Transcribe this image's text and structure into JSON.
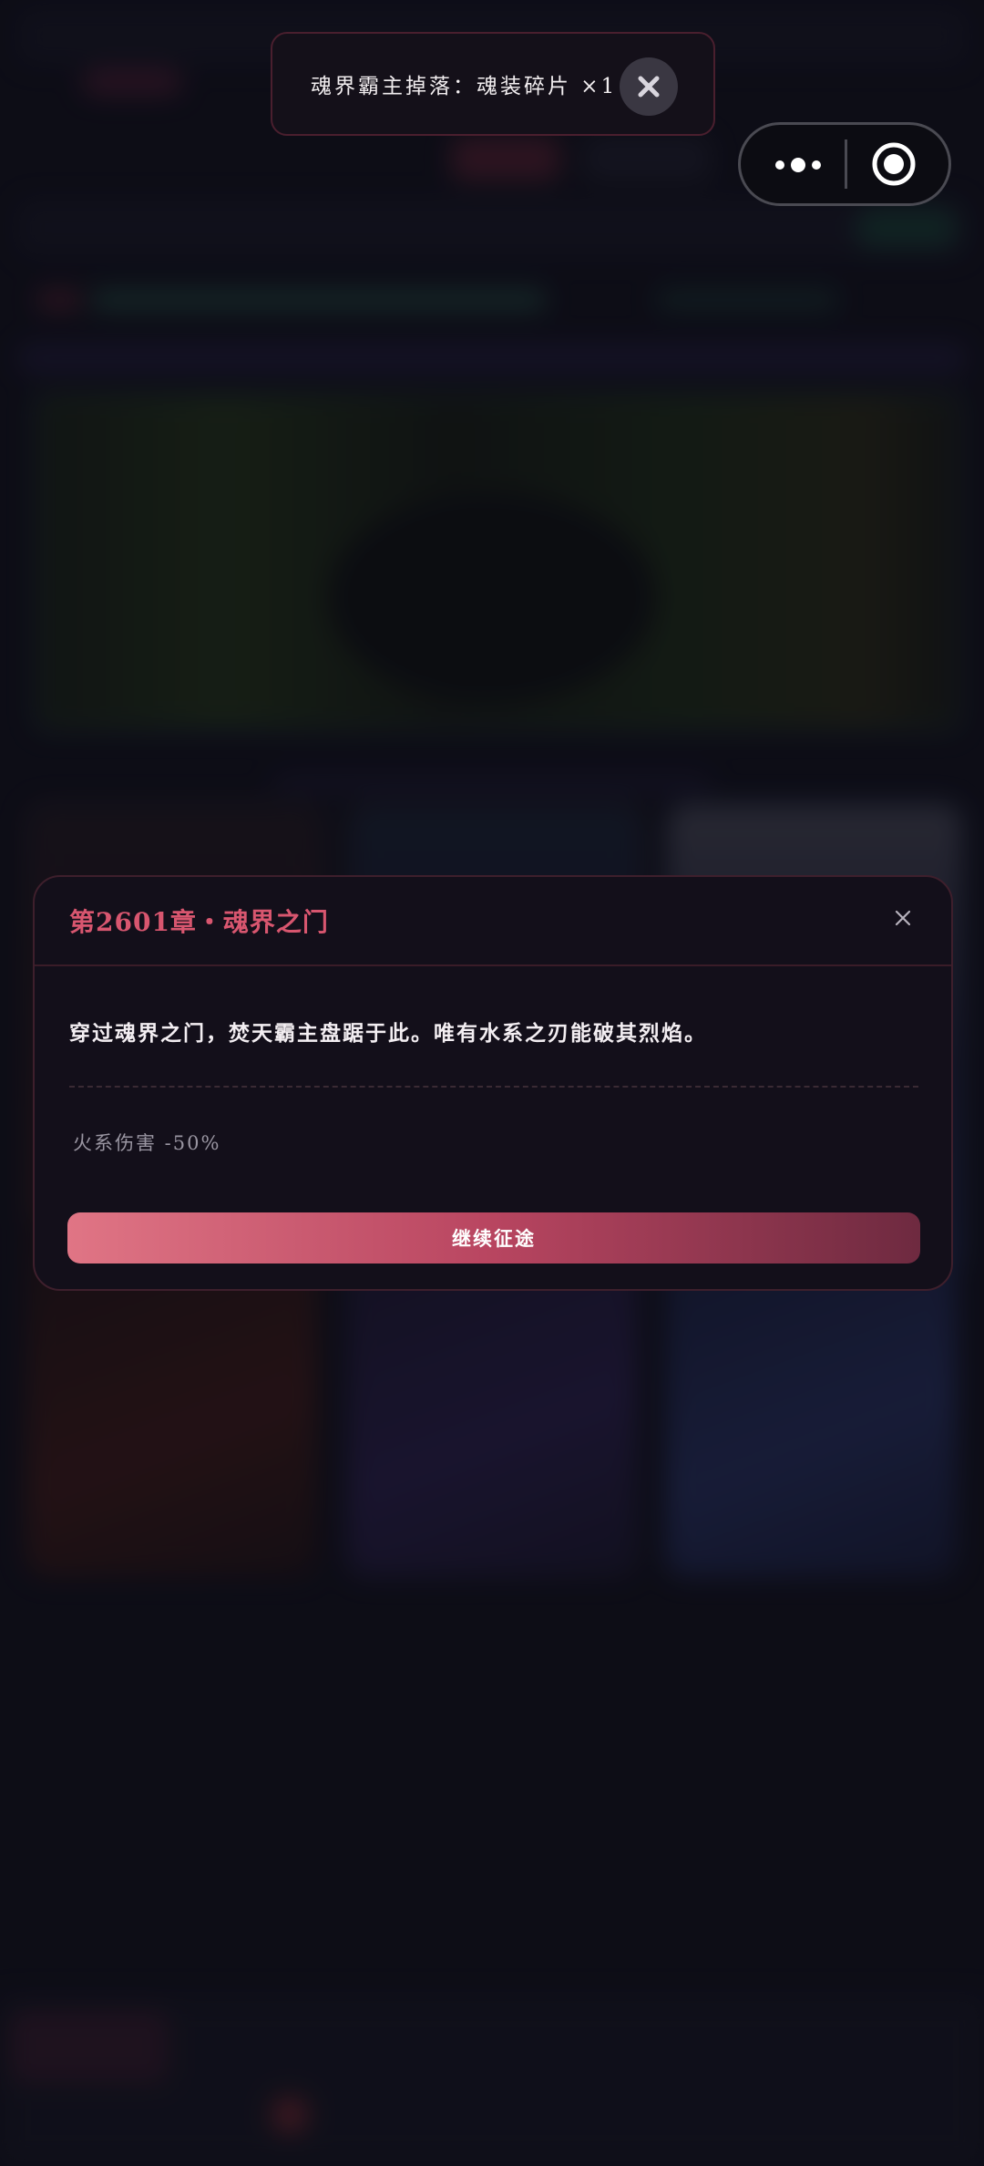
{
  "toast": {
    "message": "魂界霸主掉落：魂装碎片 ×1",
    "close_icon": "close-icon"
  },
  "capsule": {
    "more_icon": "more-dots-icon",
    "close_icon": "target-circle-icon"
  },
  "modal": {
    "title": "第2601章・魂界之门",
    "close_icon": "close-icon",
    "description": "穿过魂界之门，焚天霸主盘踞于此。唯有水系之刃能破其烈焰。",
    "effect": "火系伤害 -50%",
    "button_label": "继续征途"
  },
  "colors": {
    "accent_title": "#d8566f",
    "button_gradient_start": "#e07585",
    "button_gradient_end": "#6e2a40",
    "modal_bg": "#130f1a",
    "page_bg": "#11111d"
  }
}
